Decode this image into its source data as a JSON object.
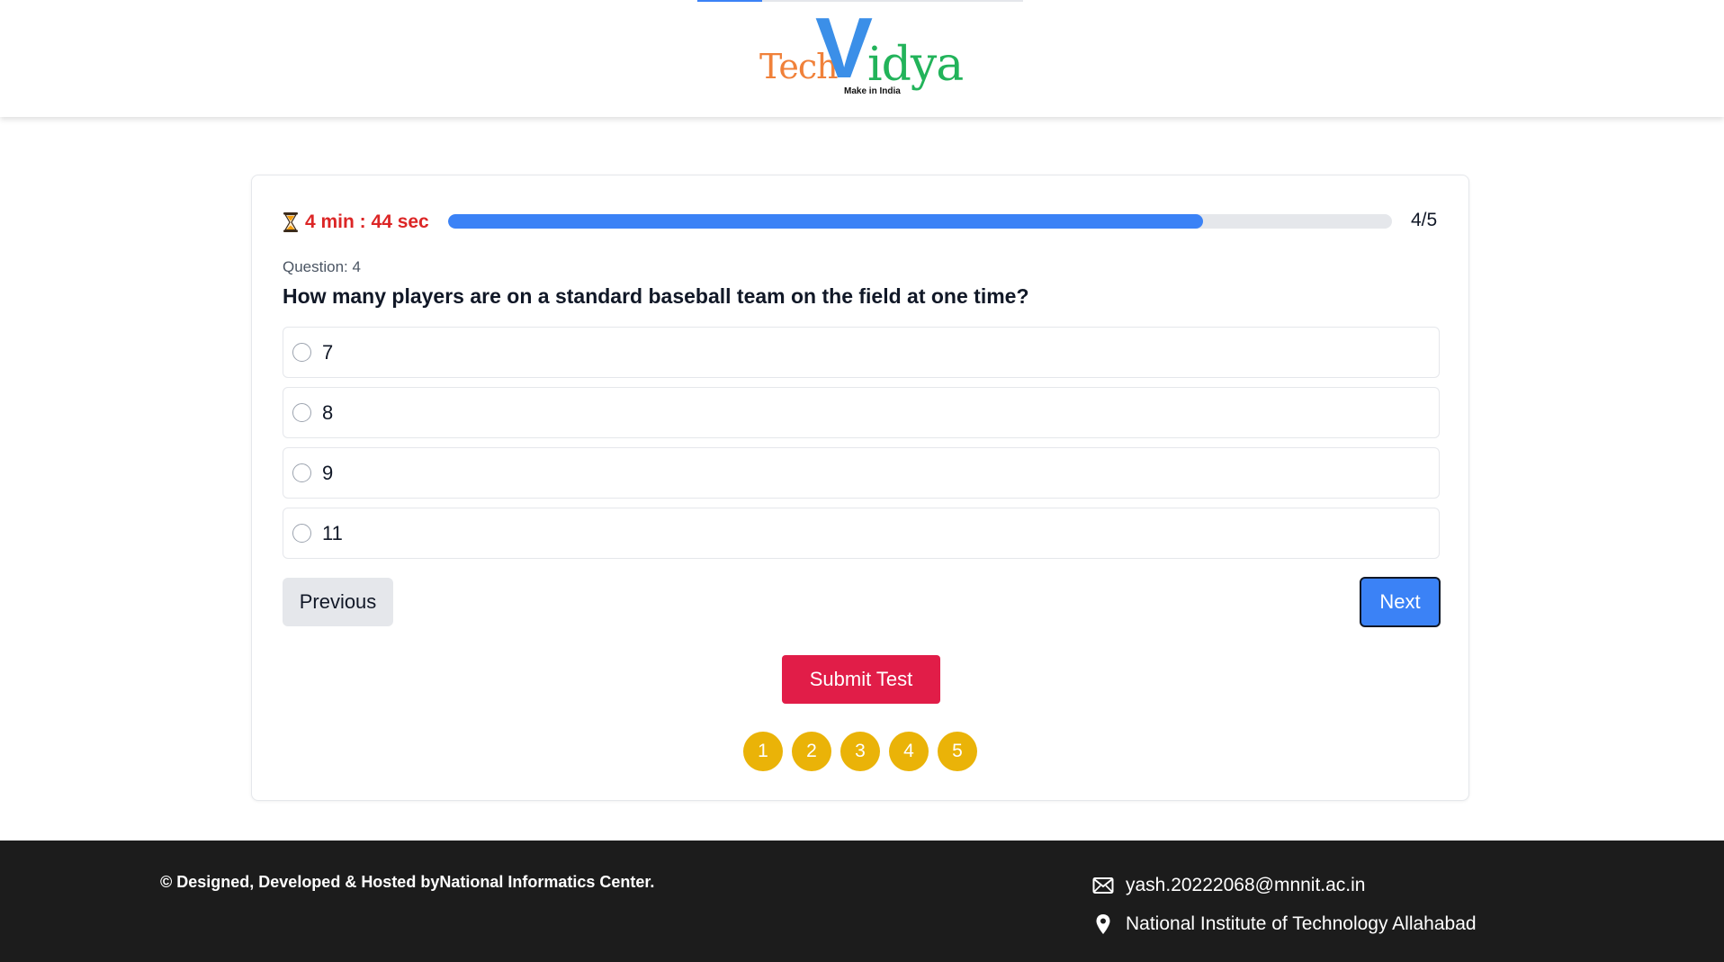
{
  "header": {
    "logo": {
      "tech": "Tech",
      "v": "V",
      "idya": "idya",
      "tagline": "Make in India"
    }
  },
  "quiz": {
    "timer": "4 min : 44 sec",
    "progress_fraction": 0.8,
    "progress_label": "4/5",
    "question_label": "Question: 4",
    "question_text": "How many players are on a standard baseball team on the field at one time?",
    "options": [
      "7",
      "8",
      "9",
      "11"
    ],
    "previous_label": "Previous",
    "next_label": "Next",
    "submit_label": "Submit Test",
    "question_numbers": [
      "1",
      "2",
      "3",
      "4",
      "5"
    ]
  },
  "footer": {
    "copyright": "© Designed, Developed & Hosted byNational Informatics Center.",
    "email": "yash.20222068@mnnit.ac.in",
    "address": "National Institute of Technology Allahabad"
  },
  "colors": {
    "accent": "#3b82f6",
    "timer": "#dc2626",
    "submit": "#e11d48",
    "question_nav": "#eab308",
    "footer_bg": "#1c1c1c"
  },
  "icons": {
    "timer": "hourglass-icon",
    "email": "envelope-icon",
    "address": "map-pin-icon"
  }
}
